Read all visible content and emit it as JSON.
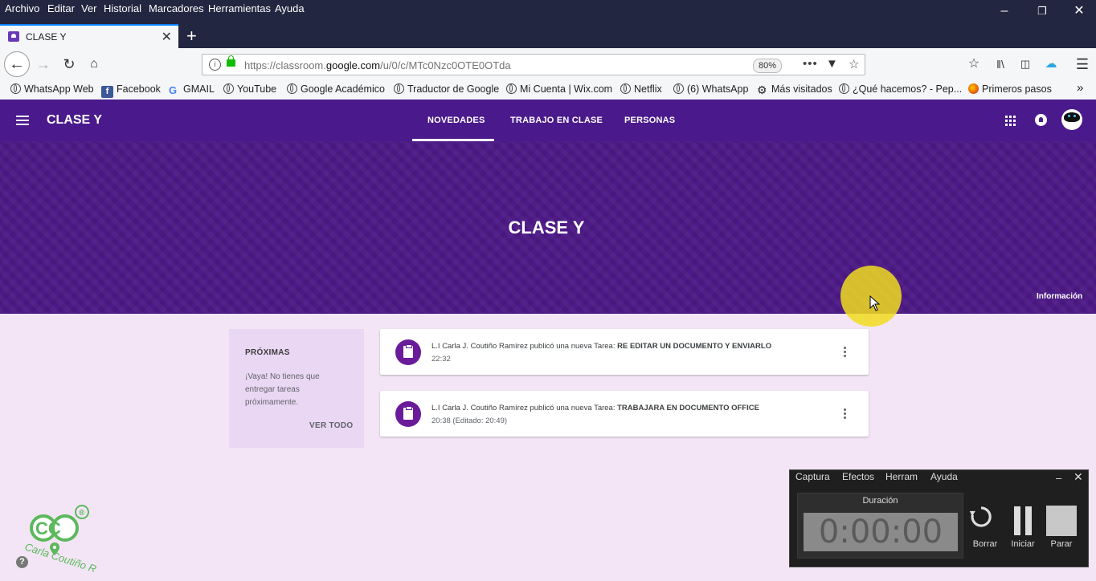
{
  "menubar": {
    "items": [
      "Archivo",
      "Editar",
      "Ver",
      "Historial",
      "Marcadores",
      "Herramientas",
      "Ayuda"
    ]
  },
  "tab": {
    "title": "CLASE Y"
  },
  "navbar": {
    "url_prefix": "https://classroom.",
    "url_domain": "google.com",
    "url_path": "/u/0/c/MTc0Nzc0OTE0OTda",
    "zoom": "80%"
  },
  "bookmarks": [
    {
      "label": "WhatsApp Web",
      "icon": "globe-icon"
    },
    {
      "label": "Facebook",
      "icon": "facebook-icon"
    },
    {
      "label": "GMAIL",
      "icon": "google-icon"
    },
    {
      "label": "YouTube",
      "icon": "globe-icon"
    },
    {
      "label": "Google Académico",
      "icon": "globe-icon"
    },
    {
      "label": "Traductor de Google",
      "icon": "globe-icon"
    },
    {
      "label": "Mi Cuenta | Wix.com",
      "icon": "globe-icon"
    },
    {
      "label": "Netflix",
      "icon": "globe-icon"
    },
    {
      "label": "(6) WhatsApp",
      "icon": "globe-icon"
    },
    {
      "label": "Más visitados",
      "icon": "gear-icon"
    },
    {
      "label": "¿Qué hacemos? - Pep...",
      "icon": "globe-icon"
    },
    {
      "label": "Primeros pasos",
      "icon": "firefox-icon"
    }
  ],
  "classroom": {
    "class_name": "CLASE Y",
    "tabs": [
      "NOVEDADES",
      "TRABAJO EN CLASE",
      "PERSONAS"
    ],
    "banner_title": "CLASE Y",
    "info_link": "Información",
    "colors": {
      "header": "#4a1a8c",
      "banner": "#4d1a87",
      "page_bg": "#f3e5f5",
      "post_icon": "#6a1b9a"
    }
  },
  "upcoming": {
    "title": "PRÓXIMAS",
    "text": "¡Vaya! No tienes que entregar tareas próximamente.",
    "view_all": "VER TODO"
  },
  "posts": [
    {
      "author_text": "L.I Carla J. Coutiño Ramírez publicó una nueva Tarea: ",
      "title": "RE EDITAR UN DOCUMENTO Y ENVIARLO",
      "time": "22:32"
    },
    {
      "author_text": "L.I Carla J. Coutiño Ramírez publicó una nueva Tarea: ",
      "title": "TRABAJARA EN DOCUMENTO OFFICE",
      "time": "20:38 (Editado: 20:49)"
    }
  ],
  "watermark": {
    "letters": "CC",
    "registered": "®",
    "name": "Carla Coutiño R"
  },
  "recorder": {
    "menu": [
      "Captura",
      "Efectos",
      "Herram",
      "Ayuda"
    ],
    "duration_label": "Duración",
    "duration": "0:00:00",
    "buttons": [
      "Borrar",
      "Iniciar",
      "Parar"
    ]
  }
}
